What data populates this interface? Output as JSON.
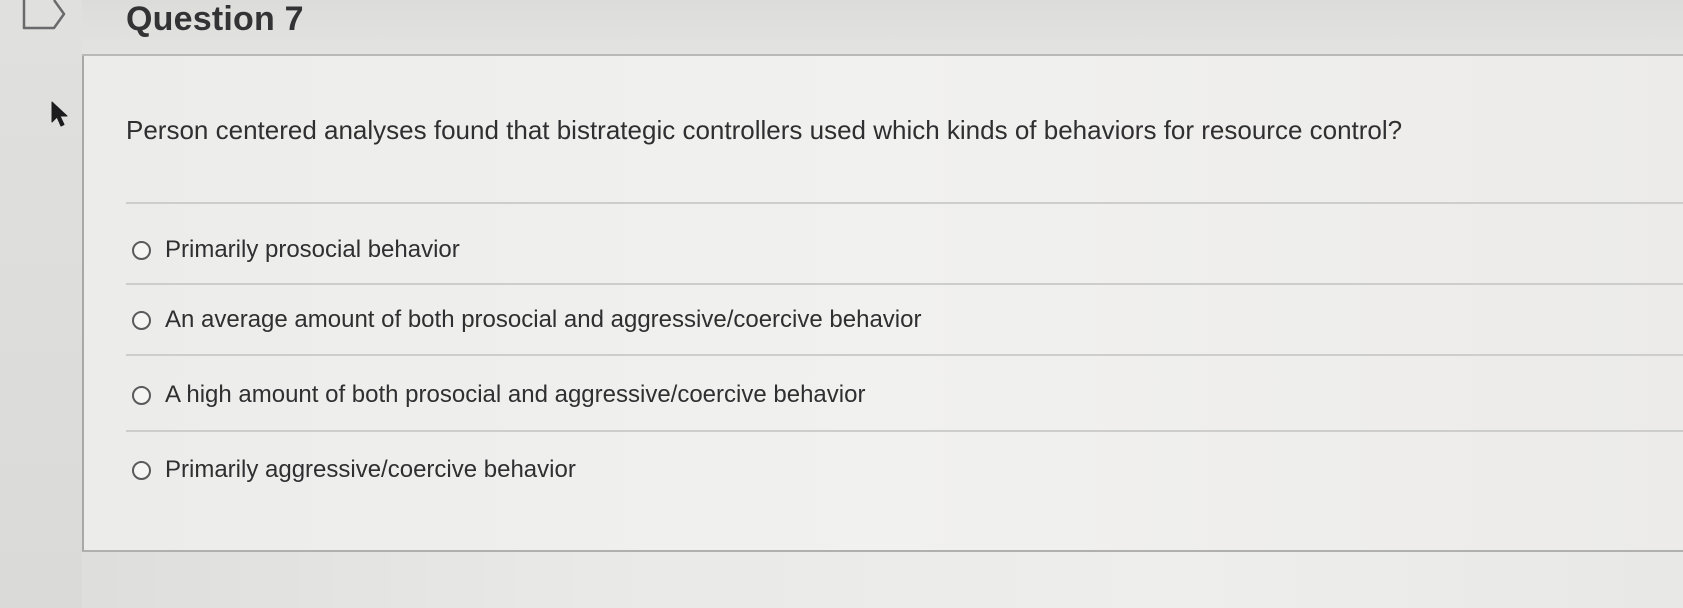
{
  "question": {
    "title": "Question 7",
    "prompt": "Person centered analyses found that bistrategic controllers used which kinds of behaviors for resource control?",
    "options": [
      {
        "label": "Primarily prosocial behavior",
        "selected": false
      },
      {
        "label": "An average amount of both prosocial and aggressive/coercive behavior",
        "selected": false
      },
      {
        "label": "A high amount of both prosocial and aggressive/coercive behavior",
        "selected": false
      },
      {
        "label": "Primarily aggressive/coercive behavior",
        "selected": false
      }
    ]
  },
  "icons": {
    "flag": "flag-outline-icon",
    "cursor": "mouse-pointer-icon"
  },
  "colors": {
    "background": "#e9e9e7",
    "text": "#2f2f31",
    "divider": "#cdcdcb",
    "radio_border": "#5a5a5c"
  }
}
